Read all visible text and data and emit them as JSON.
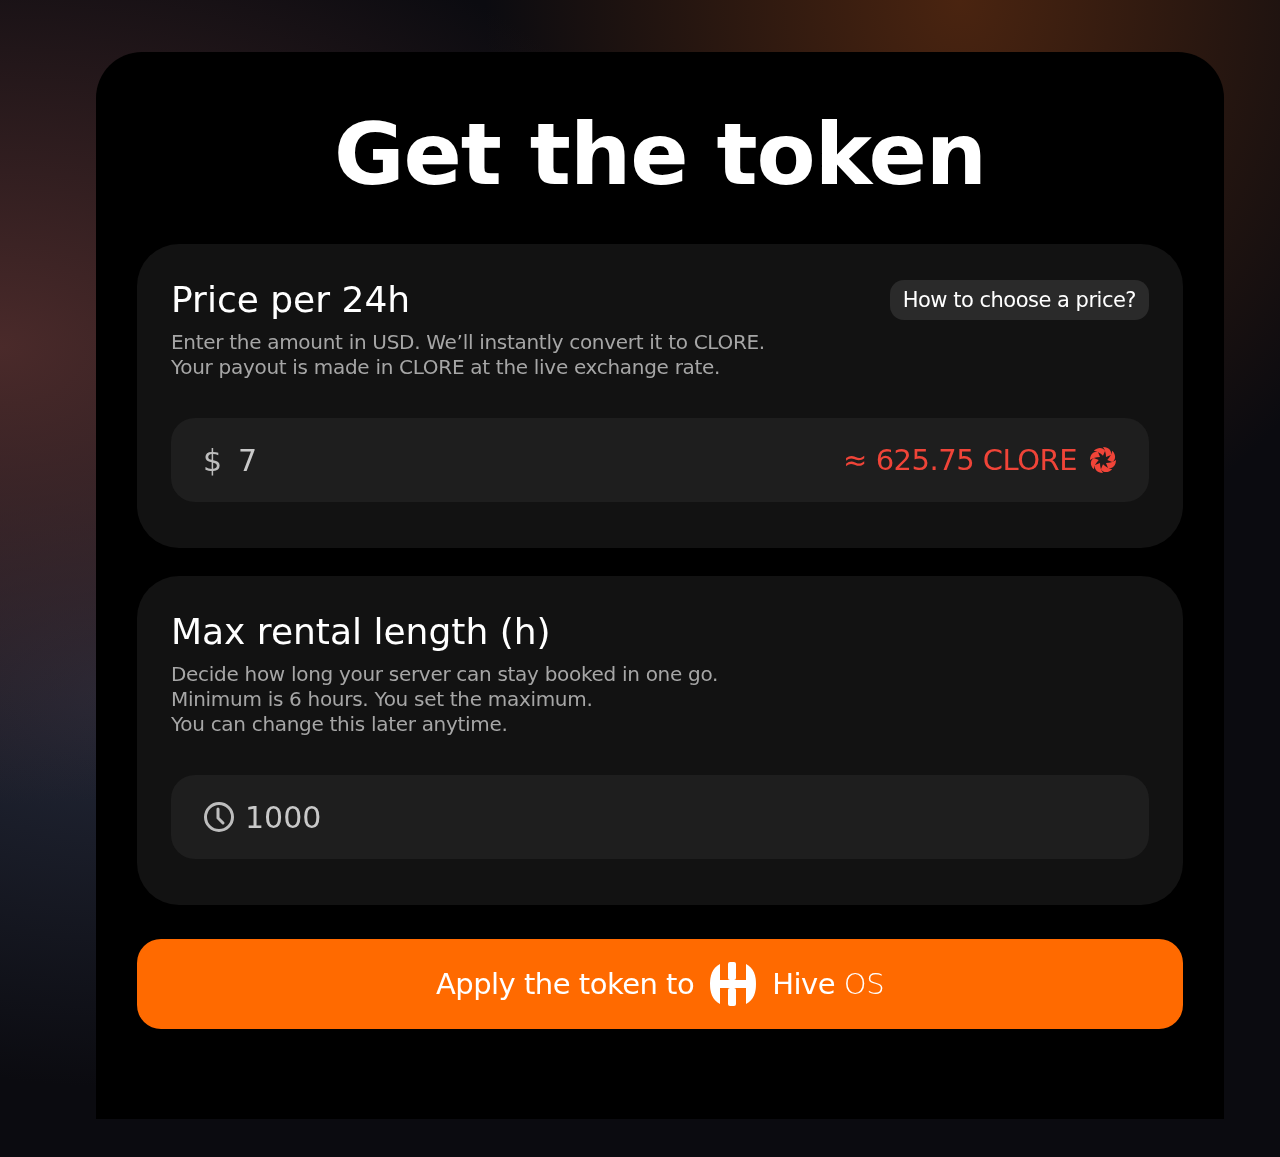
{
  "title": "Get the token",
  "sections": [
    {
      "kind": "price",
      "heading": "Price per 24h",
      "help_button": "How to choose a price?",
      "description": [
        "Enter the amount in USD. We’ll instantly convert it to CLORE.",
        "Your payout is made in CLORE at the live exchange rate."
      ],
      "field": {
        "prefix": "$",
        "value": "7",
        "conversion": "≈ 625.75 CLORE"
      }
    },
    {
      "kind": "duration",
      "heading": "Max rental length (h)",
      "description": [
        "Decide how long your server can stay booked in one go.",
        "Minimum is 6 hours. You set the maximum.",
        "You can change this later anytime."
      ],
      "field": {
        "value": "1000"
      }
    }
  ],
  "apply_button": {
    "label": "Apply the token to",
    "brand": "**Hive** OS"
  }
}
